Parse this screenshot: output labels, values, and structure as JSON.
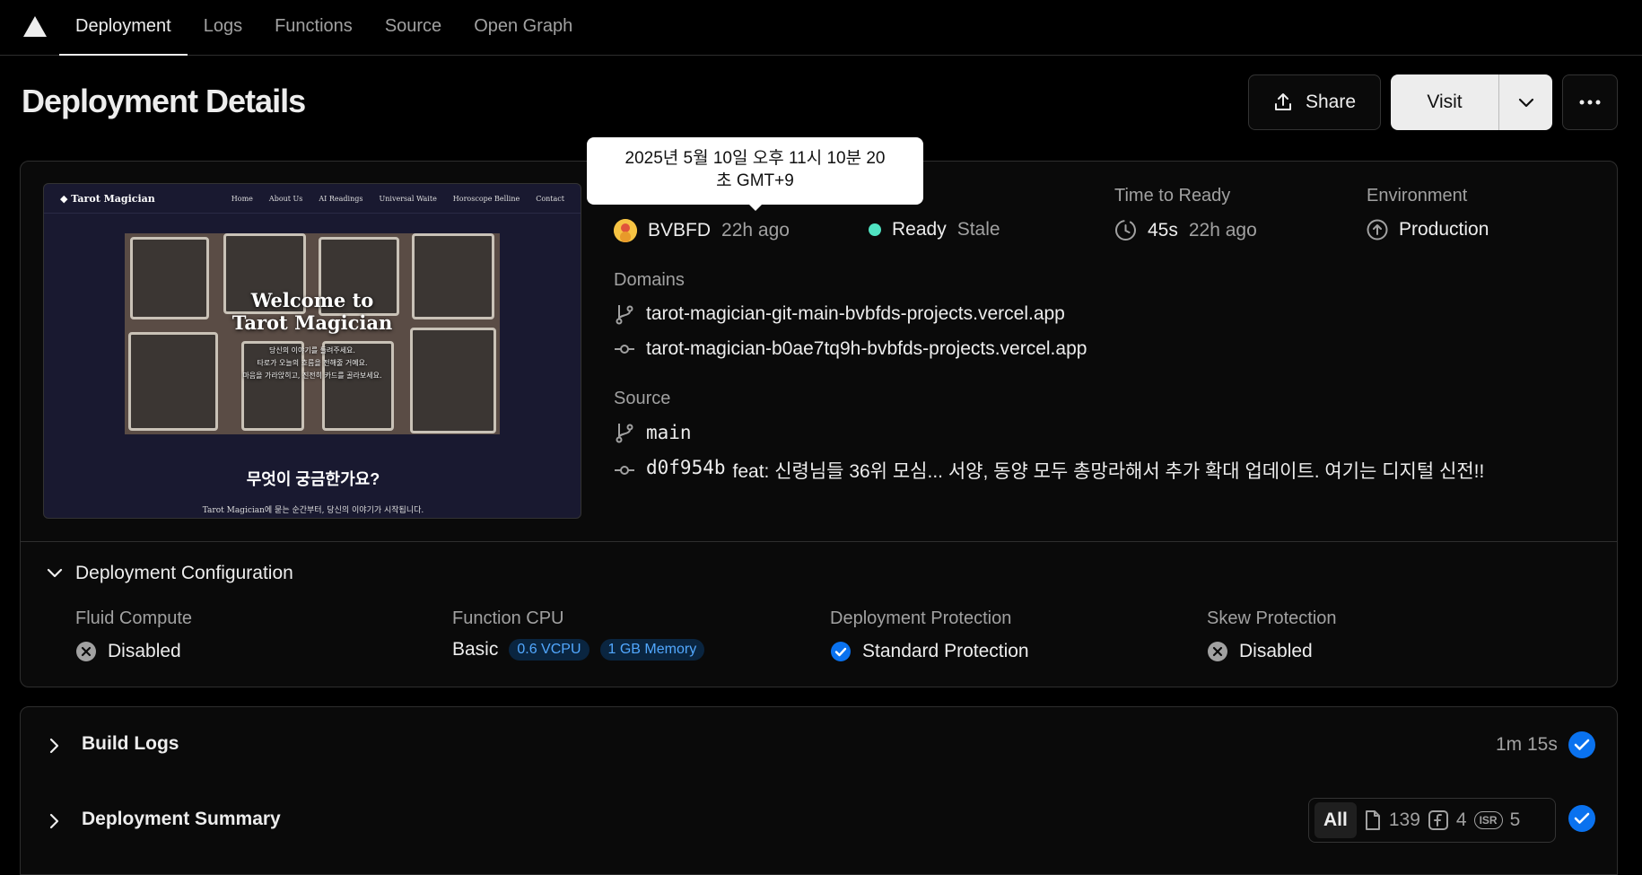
{
  "nav": {
    "tabs": [
      "Deployment",
      "Logs",
      "Functions",
      "Source",
      "Open Graph"
    ]
  },
  "header": {
    "title": "Deployment Details",
    "share_label": "Share",
    "visit_label": "Visit"
  },
  "tooltip": {
    "line1": "2025년 5월 10일 오후 11시 10분 20",
    "line2": "초 GMT+9"
  },
  "preview": {
    "brand": "Tarot Magician",
    "links": [
      "Home",
      "About Us",
      "AI Readings",
      "Universal Waite",
      "Horoscope Belline",
      "Contact"
    ],
    "hero_title_1": "Welcome to",
    "hero_title_2": "Tarot Magician",
    "hero_sub_1": "당신의 이야기를 들려주세요.",
    "hero_sub_2": "타로가 오늘의 흐름을 전해줄 거예요.",
    "hero_sub_3": "마음을 가라앉히고, 진전히 카드를 골라보세요.",
    "section_title": "무엇이 궁금한가요?",
    "section_text": "Tarot Magician에 묻는 순간부터, 당신의 이야기가 시작됩니다."
  },
  "details": {
    "creator": "BVBFD",
    "creator_time": "22h ago",
    "status": "Ready",
    "status_note": "Stale",
    "time_to_ready_label": "Time to Ready",
    "time_to_ready": "45s",
    "time_to_ready_ago": "22h ago",
    "environment_label": "Environment",
    "environment": "Production",
    "domains_label": "Domains",
    "domains": [
      "tarot-magician-git-main-bvbfds-projects.vercel.app",
      "tarot-magician-b0ae7tq9h-bvbfds-projects.vercel.app"
    ],
    "source_label": "Source",
    "branch": "main",
    "commit_hash": "d0f954b",
    "commit_message": "feat: 신령님들 36위 모심... 서양, 동양 모두 총망라해서 추가 확대 업데이트. 여기는 디지털 신전!!"
  },
  "config": {
    "title": "Deployment Configuration",
    "fluid_label": "Fluid Compute",
    "fluid_value": "Disabled",
    "cpu_label": "Function CPU",
    "cpu_value": "Basic",
    "cpu_vcpu": "0.6 VCPU",
    "cpu_memory": "1 GB Memory",
    "protection_label": "Deployment Protection",
    "protection_value": "Standard Protection",
    "skew_label": "Skew Protection",
    "skew_value": "Disabled"
  },
  "build_logs": {
    "title": "Build Logs",
    "duration": "1m 15s"
  },
  "summary": {
    "title": "Deployment Summary",
    "all_label": "All",
    "static_count": "139",
    "function_count": "4",
    "isr_label": "ISR",
    "isr_count": "5"
  },
  "colors": {
    "background": "#000000",
    "card": "#0a0a0a",
    "ready": "#50e3c2",
    "accent": "#0a72ef",
    "pill_text": "#52a8ff"
  }
}
